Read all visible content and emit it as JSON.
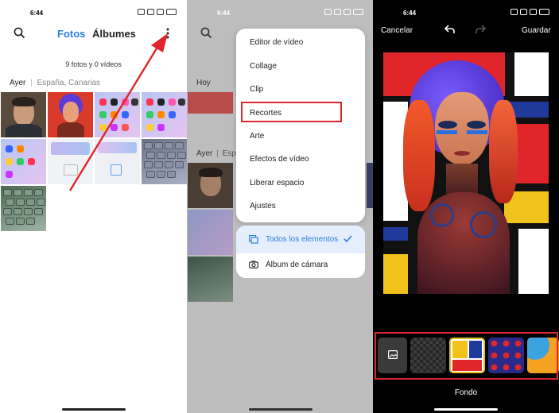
{
  "panel1": {
    "time": "6:44",
    "battery": "87",
    "tabs": {
      "fotos": "Fotos",
      "albumes": "Álbumes"
    },
    "count_text": "9 fotos y 0 vídeos",
    "section_day": "Ayer",
    "section_place": "España, Canarias"
  },
  "panel2": {
    "time": "6:44",
    "behind_labels": {
      "hoy": "Hoy",
      "ayer": "Ayer",
      "esp": "Espa"
    },
    "menu": {
      "items": [
        "Editor de vídeo",
        "Collage",
        "Clip",
        "Recortes",
        "Arte",
        "Efectos de vídeo",
        "Liberar espacio",
        "Ajustes"
      ],
      "highlighted": "Recortes"
    },
    "filter": {
      "selected": "Todos los elementos",
      "other": "Álbum de cámara"
    }
  },
  "panel3": {
    "time": "6:44",
    "cancel": "Cancelar",
    "save": "Guardar",
    "caption": "Fondo"
  },
  "colors": {
    "accent_blue": "#2f7fe0",
    "annotation_red": "#e0252b",
    "mondrian_red": "#e0262b",
    "mondrian_blue": "#1f3a9b",
    "mondrian_yellow": "#f1c21b"
  },
  "icons": [
    "search-icon",
    "more-vertical-icon",
    "check-icon",
    "image-icon",
    "camera-icon",
    "undo-icon",
    "redo-icon",
    "all-items-icon"
  ]
}
